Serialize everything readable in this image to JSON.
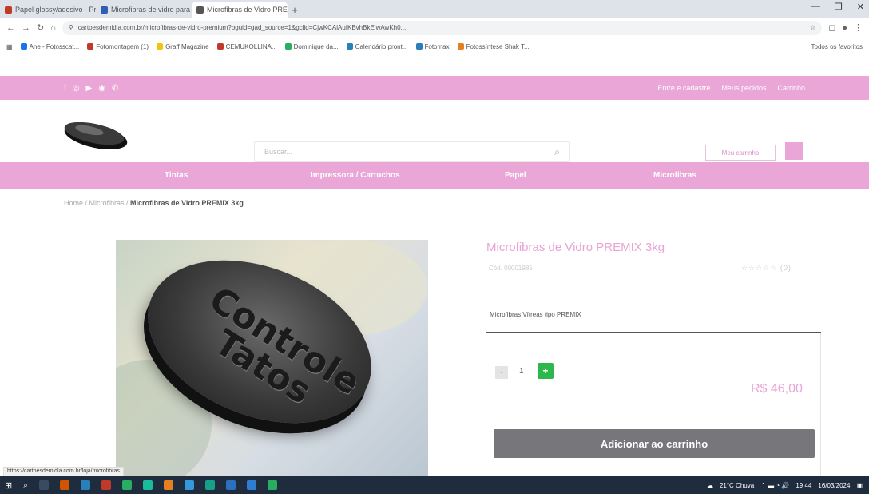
{
  "browser": {
    "tabs": [
      {
        "label": "Papel glossy/adesivo - Pri",
        "color": "#c0392b",
        "active": false
      },
      {
        "label": "Microfibras de vidro para 3",
        "color": "#2e5fb8",
        "active": false
      },
      {
        "label": "Microfibras de Vidro PREMI",
        "color": "#555555",
        "active": true
      }
    ],
    "new_tab": "+",
    "url": "cartoesdemidia.com.br/microfibras-de-vidro-premium?bguid=gad_source=1&gclid=CjwKCAiAuIKBvhBkEiwAwKh0...",
    "bookmarks": [
      "Ane - Fotosscat...",
      "Fotomontagem (1)",
      "Graff Magazine",
      "CEMUKOLLINA...",
      "Dominique da...",
      "Calendário pront...",
      "Fotomax",
      "Fotossíntese Shak T..."
    ],
    "bookmarks_right": "Todos os favoritos"
  },
  "site": {
    "top_links": [
      "Entre e cadastre",
      "Meus pedidos",
      "Carrinho"
    ],
    "search_placeholder": "Buscar...",
    "cart_button": "Meu carrinho",
    "nav": [
      "Tintas",
      "Impressora / Cartuchos",
      "Papel",
      "Microfibras"
    ],
    "breadcrumb_prefix": "Home / Microfibras / ",
    "breadcrumb_current": "Microfibras de Vidro PREMIX 3kg",
    "product_image_text": [
      "Controle",
      "Tatos"
    ],
    "product": {
      "title": "Microfibras de Vidro PREMIX 3kg",
      "sku": "Cód. 00001985",
      "rating_text": "☆☆☆☆☆ (0)",
      "description_tab": "Microfibras Vítreas tipo PREMIX",
      "quantity": "1",
      "qty_minus": "-",
      "qty_plus": "+",
      "price": "R$ 46,00",
      "add_to_cart": "Adicionar ao carrinho"
    }
  },
  "status_url": "https://cartoesdemidia.com.br/loja/microfibras",
  "taskbar": {
    "weather": "21°C Chuva",
    "time": "19:44",
    "date": "16/03/2024"
  },
  "colors": {
    "accent_pink": "#e9a6d7",
    "button_gray": "#77767a",
    "plus_green": "#2db84d"
  }
}
